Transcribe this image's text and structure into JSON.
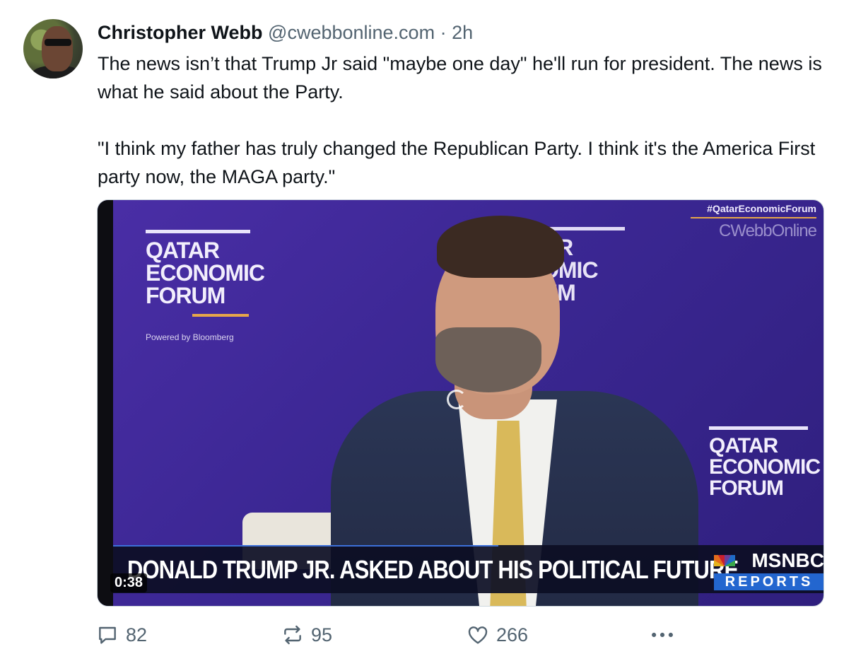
{
  "post": {
    "author_name": "Christopher Webb",
    "handle": "@cwebbonline.com",
    "separator": "·",
    "time": "2h",
    "text_paragraphs": [
      "The news isn’t that Trump Jr said \"maybe one day\" he'll run for president. The news is what he said about the Party.",
      "\"I think my father has truly changed the Republican Party. I think it's the America First party now, the MAGA party.\""
    ]
  },
  "video": {
    "duration": "0:38",
    "headline": "DONALD TRUMP JR. ASKED ABOUT HIS POLITICAL FUTURE",
    "network": "MSNBC",
    "network_sub": "REPORTS",
    "hashtag": "#QatarEconomicForum",
    "watermark": "CWebbOnline",
    "forum_logo_lines": [
      "QATAR",
      "ECONOMIC",
      "FORUM"
    ],
    "forum_logo_partial_lines": [
      "AR",
      "OMIC",
      "UM"
    ],
    "powered_by": "Powered by Bloomberg"
  },
  "actions": {
    "reply_count": "82",
    "repost_count": "95",
    "like_count": "266"
  },
  "icons": {
    "reply": "reply-icon",
    "repost": "repost-icon",
    "like": "heart-icon",
    "more": "more-options-icon",
    "loading": "loading-spinner-icon"
  },
  "colors": {
    "text_primary": "#0f1419",
    "text_secondary": "#536471",
    "video_bg": "#3b2793",
    "msnbc_blue": "#2366cf"
  }
}
